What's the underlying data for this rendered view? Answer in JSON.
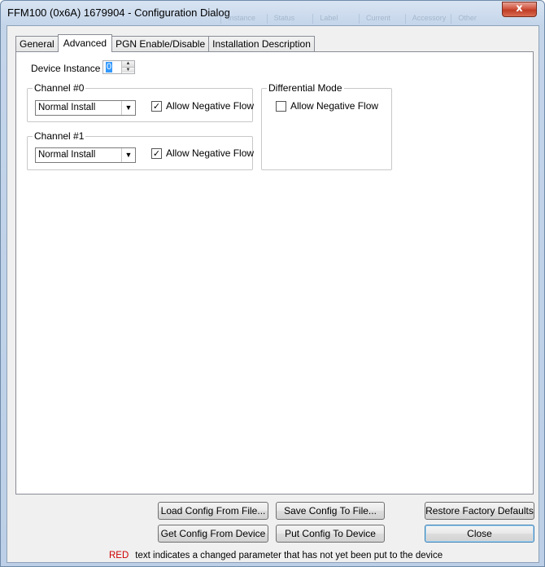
{
  "window": {
    "title": "FFM100 (0x6A) 1679904 - Configuration Dialog",
    "close_glyph": "x",
    "ghost_header": [
      "Instance",
      "Status",
      "Label",
      "Current",
      "Accessory",
      "Other"
    ]
  },
  "tabs": [
    {
      "label": "General",
      "active": false
    },
    {
      "label": "Advanced",
      "active": true
    },
    {
      "label": "PGN Enable/Disable",
      "active": false
    },
    {
      "label": "Installation Description",
      "active": false
    }
  ],
  "device_instance": {
    "label": "Device Instance :",
    "value": "0"
  },
  "channel0": {
    "title": "Channel #0",
    "install_mode": "Normal Install",
    "allow_negative_flow_label": "Allow Negative Flow",
    "allow_negative_flow_checked": true
  },
  "channel1": {
    "title": "Channel #1",
    "install_mode": "Normal Install",
    "allow_negative_flow_label": "Allow Negative Flow",
    "allow_negative_flow_checked": true
  },
  "differential": {
    "title": "Differential Mode",
    "allow_negative_flow_label": "Allow Negative Flow",
    "allow_negative_flow_checked": false
  },
  "buttons": {
    "load_config": "Load Config From File...",
    "save_config": "Save Config To File...",
    "restore_defaults": "Restore Factory Defaults",
    "get_config": "Get Config From Device",
    "put_config": "Put Config To Device",
    "close": "Close"
  },
  "status": {
    "red_word": "RED",
    "message": "text indicates a changed parameter that has not yet been put to the device"
  },
  "icons": {
    "check_glyph": "✓",
    "dropdown_glyph": "▼",
    "spin_up_glyph": "▲",
    "spin_down_glyph": "▼"
  },
  "colors": {
    "selection": "#3399ff",
    "warning_red": "#d00000",
    "close_button": "#c03c25"
  }
}
